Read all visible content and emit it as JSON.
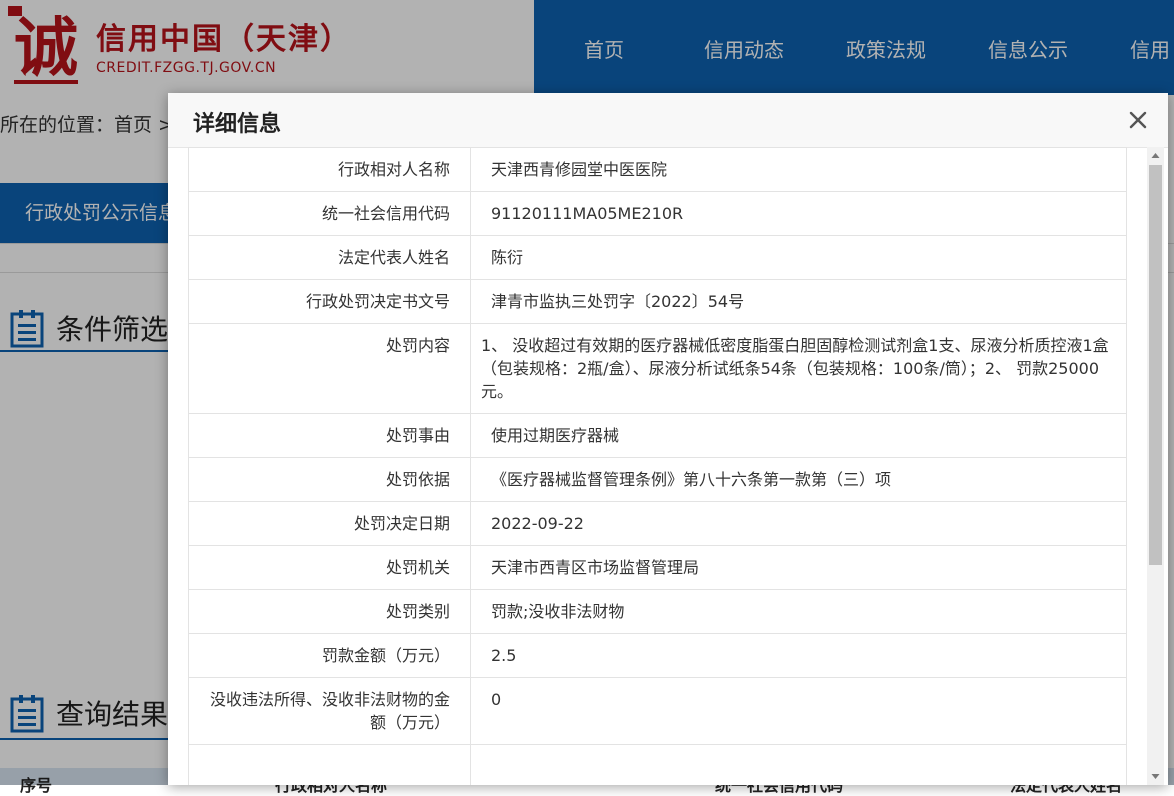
{
  "site": {
    "logo_glyph": "诚",
    "title": "信用中国（天津）",
    "url": "CREDIT.FZGG.TJ.GOV.CN",
    "brand_color": "#b8141b",
    "nav_color": "#0e62b0"
  },
  "nav": {
    "items": [
      "首页",
      "信用动态",
      "政策法规",
      "信息公示",
      "信用"
    ]
  },
  "breadcrumb": {
    "text": "所在的位置：首页 >"
  },
  "section_tab": {
    "label": "行政处罚公示信息"
  },
  "filter_section": {
    "title": "条件筛选"
  },
  "results_section": {
    "title": "查询结果",
    "columns": [
      "序号",
      "行政相对人名称",
      "统一社会信用代码",
      "法定代表人姓名"
    ]
  },
  "modal": {
    "title": "详细信息",
    "close_icon": "close-icon",
    "rows": [
      {
        "label": "行政相对人名称",
        "value": "天津西青修园堂中医医院"
      },
      {
        "label": "统一社会信用代码",
        "value": "91120111MA05ME210R"
      },
      {
        "label": "法定代表人姓名",
        "value": "陈衍"
      },
      {
        "label": "行政处罚决定书文号",
        "value": "津青市监执三处罚字〔2022〕54号"
      },
      {
        "label": "处罚内容",
        "value": " 1、 没收超过有效期的医疗器械低密度脂蛋白胆固醇检测试剂盒1支、尿液分析质控液1盒（包装规格：2瓶/盒）、尿液分析试纸条54条（包装规格：100条/筒）；2、 罚款25000元。"
      },
      {
        "label": "处罚事由",
        "value": "使用过期医疗器械"
      },
      {
        "label": "处罚依据",
        "value": "《医疗器械监督管理条例》第八十六条第一款第（三）项"
      },
      {
        "label": "处罚决定日期",
        "value": "2022-09-22"
      },
      {
        "label": "处罚机关",
        "value": "天津市西青区市场监督管理局"
      },
      {
        "label": "处罚类别",
        "value": "罚款;没收非法财物"
      },
      {
        "label": "罚款金额（万元）",
        "value": "2.5"
      },
      {
        "label": "没收违法所得、没收非法财物的金额（万元）",
        "value": "0"
      },
      {
        "label": "",
        "value": ""
      }
    ]
  }
}
